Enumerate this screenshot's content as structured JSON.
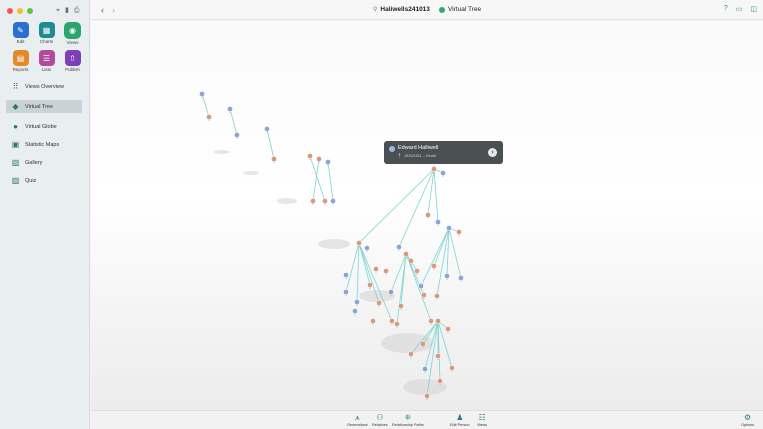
{
  "window": {
    "toolbar_icons": [
      "tag-icon",
      "bookmark-icon",
      "print-icon"
    ]
  },
  "sidebar": {
    "apps": [
      {
        "label": "Edit",
        "icon": "pencil-icon",
        "color": "#2b6fcf"
      },
      {
        "label": "Charts",
        "icon": "charts-grid-icon",
        "color": "#1f8a8f"
      },
      {
        "label": "Views",
        "icon": "eye-icon",
        "color": "#2aa66a",
        "selected": true
      },
      {
        "label": "Reports",
        "icon": "reports-icon",
        "color": "#e08a2a"
      },
      {
        "label": "Lists",
        "icon": "list-icon",
        "color": "#b44a9a"
      },
      {
        "label": "Publish",
        "icon": "upload-icon",
        "color": "#7d3fb5"
      }
    ],
    "nav": [
      {
        "label": "Views Overview",
        "icon": "grid-dots-icon"
      },
      {
        "label": "Virtual Tree",
        "icon": "cube-icon",
        "active": true
      },
      {
        "label": "Virtual Globe",
        "icon": "globe-icon"
      },
      {
        "label": "Statistic Maps",
        "icon": "map-icon"
      },
      {
        "label": "Gallery",
        "icon": "gallery-icon"
      },
      {
        "label": "Quiz",
        "icon": "quiz-icon"
      }
    ]
  },
  "topbar": {
    "document": "Haliwells241013",
    "view": "Virtual Tree",
    "right_icons": [
      "help-icon",
      "sidebar-toggle-icon",
      "split-view-icon"
    ]
  },
  "tooltip": {
    "name": "Edward Halliwell",
    "detail": "1820/1811 – Death"
  },
  "bottom_toolbar": [
    {
      "label": "Generations",
      "icon": "generations-icon"
    },
    {
      "label": "Relatives",
      "icon": "relatives-icon"
    },
    {
      "label": "Relationship Paths",
      "icon": "relationship-paths-icon"
    },
    {
      "label": "Edit Person",
      "icon": "edit-person-icon"
    },
    {
      "label": "Views",
      "icon": "views-icon"
    },
    {
      "label": "Options",
      "icon": "options-icon"
    }
  ],
  "colors": {
    "accent": "#2aa66a",
    "link": "#7fd3d3",
    "male": "#8aa4d8",
    "female": "#d99a7c"
  }
}
